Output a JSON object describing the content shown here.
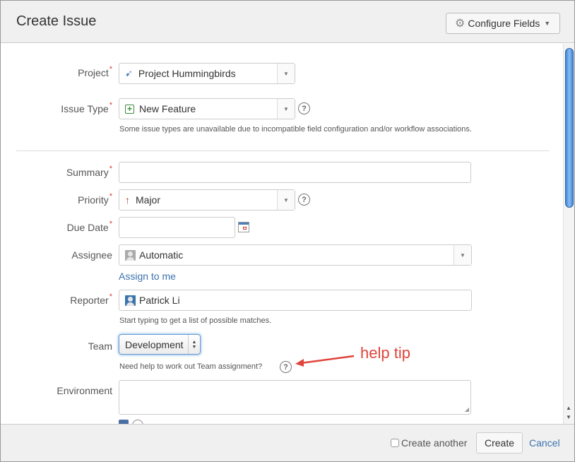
{
  "header": {
    "title": "Create Issue",
    "configure_fields_label": "Configure Fields"
  },
  "form": {
    "project": {
      "label": "Project",
      "required": true,
      "value": "Project Hummingbirds"
    },
    "issue_type": {
      "label": "Issue Type",
      "required": true,
      "value": "New Feature",
      "description": "Some issue types are unavailable due to incompatible field configuration and/or workflow associations."
    },
    "summary": {
      "label": "Summary",
      "required": true,
      "value": ""
    },
    "priority": {
      "label": "Priority",
      "required": true,
      "value": "Major"
    },
    "due_date": {
      "label": "Due Date",
      "required": true,
      "value": ""
    },
    "assignee": {
      "label": "Assignee",
      "required": false,
      "value": "Automatic",
      "assign_to_me": "Assign to me"
    },
    "reporter": {
      "label": "Reporter",
      "required": true,
      "value": "Patrick Li",
      "description": "Start typing to get a list of possible matches."
    },
    "team": {
      "label": "Team",
      "required": false,
      "value": "Development",
      "description": "Need help to work out Team assignment?"
    },
    "environment": {
      "label": "Environment",
      "required": false,
      "value": ""
    }
  },
  "annotation": {
    "text": "help tip",
    "color": "#e0443a"
  },
  "footer": {
    "create_another_label": "Create another",
    "create_another_checked": false,
    "create_label": "Create",
    "cancel_label": "Cancel"
  },
  "colors": {
    "required": "#d04437",
    "link": "#3b73af"
  },
  "required_marker": "*"
}
